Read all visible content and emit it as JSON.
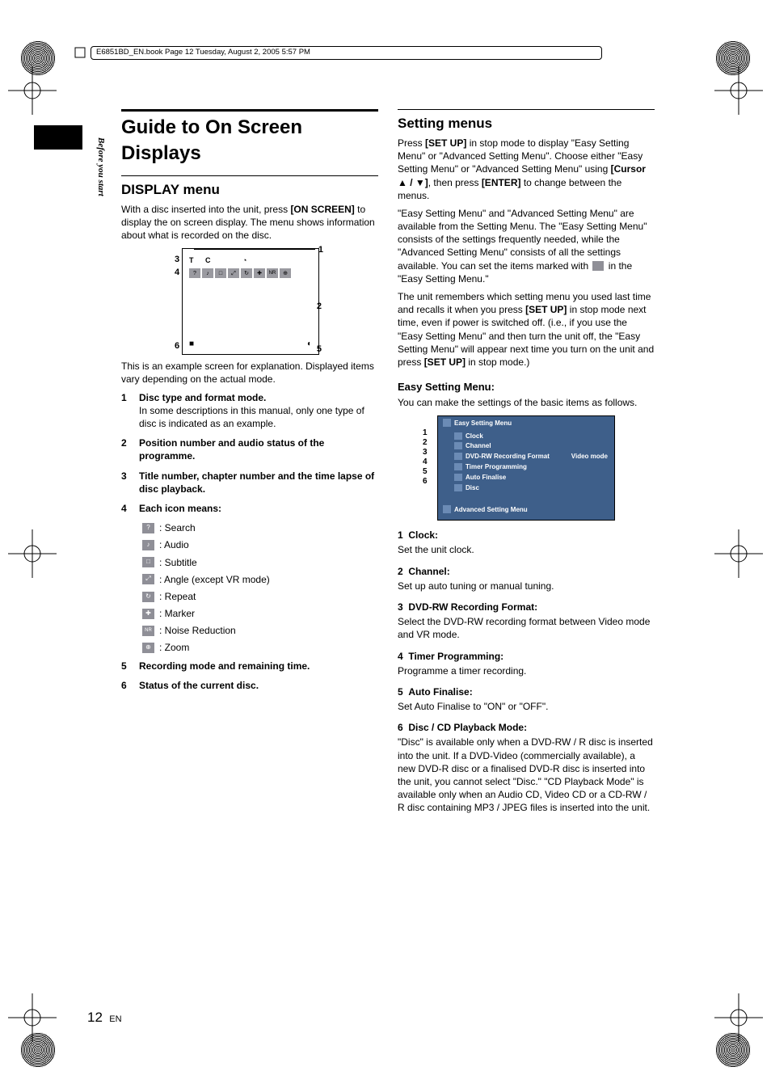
{
  "header_line": "E6851BD_EN.book  Page 12  Tuesday, August 2, 2005  5:57 PM",
  "side_label": "Before you start",
  "page_number": "12",
  "page_lang": "EN",
  "left": {
    "h1": "Guide to On Screen Displays",
    "h2": "DISPLAY menu",
    "intro_pre": "With a disc inserted into the unit, press ",
    "intro_key": "[ON SCREEN]",
    "intro_post": " to display the on screen display. The menu shows information about what is recorded on the disc.",
    "osd_top": "T   C",
    "osd_caption": "This is an example screen for explanation. Displayed items vary depending on the actual mode.",
    "items": [
      {
        "n": "1",
        "b": "Disc type and format mode.",
        "t": "In some descriptions in this manual, only one type of disc is indicated as an example."
      },
      {
        "n": "2",
        "b": "Position number and audio status of the programme.",
        "t": ""
      },
      {
        "n": "3",
        "b": "Title number, chapter number and the time lapse of disc playback.",
        "t": ""
      },
      {
        "n": "4",
        "b": "Each icon means:",
        "t": ""
      }
    ],
    "icons": [
      {
        "k": "search-icon",
        "g": "?",
        "t": ": Search"
      },
      {
        "k": "audio-icon",
        "g": "♪",
        "t": ": Audio"
      },
      {
        "k": "subtitle-icon",
        "g": "□",
        "t": ": Subtitle"
      },
      {
        "k": "angle-icon",
        "g": "⤢",
        "t": ": Angle (except VR mode)"
      },
      {
        "k": "repeat-icon",
        "g": "↻",
        "t": ": Repeat"
      },
      {
        "k": "marker-icon",
        "g": "✚",
        "t": ": Marker"
      },
      {
        "k": "nr-icon",
        "g": "NR",
        "t": ": Noise Reduction"
      },
      {
        "k": "zoom-icon",
        "g": "⊕",
        "t": ": Zoom"
      }
    ],
    "items_tail": [
      {
        "n": "5",
        "b": "Recording mode and remaining time.",
        "t": ""
      },
      {
        "n": "6",
        "b": "Status of the current disc.",
        "t": ""
      }
    ]
  },
  "right": {
    "h2a": "Setting menus",
    "p1_pre": "Press ",
    "p1_k1": "[SET UP]",
    "p1_mid1": " in stop mode to display \"Easy Setting Menu\" or \"Advanced Setting Menu\". Choose either \"Easy Setting Menu\" or \"Advanced Setting Menu\" using ",
    "p1_k2": "[Cursor ▲ / ▼]",
    "p1_mid2": ", then press ",
    "p1_k3": "[ENTER]",
    "p1_post": " to change between the menus.",
    "p2_a": "\"Easy Setting Menu\" and \"Advanced Setting Menu\" are available from the Setting Menu. The \"Easy Setting Menu\" consists of the settings frequently needed, while the \"Advanced Setting Menu\" consists of all the settings available. You can set the items marked with ",
    "p2_b": " in the \"Easy Setting Menu.\"",
    "p3_a": "The unit remembers which setting menu you used last time and recalls it when you press ",
    "p3_k1": "[SET UP]",
    "p3_b": " in stop mode next time, even if power is switched off. (i.e., if you use the \"Easy Setting Menu\" and then turn the unit off, the \"Easy Setting Menu\" will appear next time you turn on the unit and press ",
    "p3_k2": "[SET UP]",
    "p3_c": " in stop mode.)",
    "h3": "Easy Setting Menu:",
    "p4": "You can make the settings of the basic items as follows.",
    "easy": {
      "title": "Easy Setting Menu",
      "items": [
        "Clock",
        "Channel",
        "DVD-RW Recording Format",
        "Timer Programming",
        "Auto Finalise",
        "Disc"
      ],
      "vmode": "Video mode",
      "adv": "Advanced Setting Menu",
      "nums": [
        "1",
        "2",
        "3",
        "4",
        "5",
        "6"
      ]
    },
    "defs": [
      {
        "n": "1",
        "b": "Clock:",
        "t": "Set the unit clock."
      },
      {
        "n": "2",
        "b": "Channel:",
        "t": "Set up auto tuning or manual tuning."
      },
      {
        "n": "3",
        "b": "DVD-RW Recording Format:",
        "t": "Select the DVD-RW recording format between Video mode and VR mode."
      },
      {
        "n": "4",
        "b": "Timer Programming:",
        "t": "Programme a timer recording."
      },
      {
        "n": "5",
        "b": "Auto Finalise:",
        "t": "Set Auto Finalise to \"ON\" or \"OFF\"."
      },
      {
        "n": "6",
        "b": "Disc / CD Playback Mode:",
        "t": "\"Disc\" is available only when a DVD-RW / R disc is inserted into the unit. If a DVD-Video (commercially available), a new DVD-R disc or a finalised DVD-R disc is inserted into the unit, you cannot select \"Disc.\" \"CD Playback Mode\" is available only when an Audio CD, Video CD or a CD-RW / R disc containing MP3 / JPEG files is inserted into the unit."
      }
    ]
  }
}
